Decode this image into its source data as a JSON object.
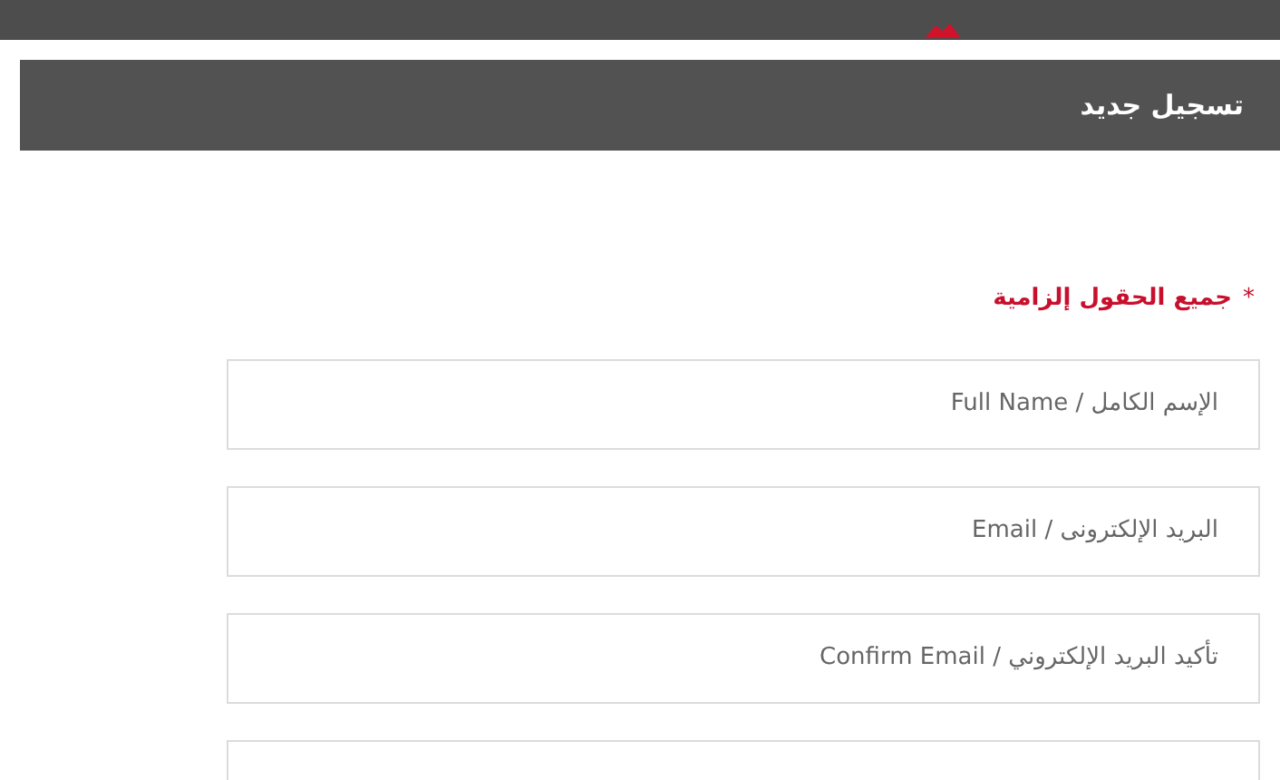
{
  "header": {
    "logo": {
      "kind": "logo"
    }
  },
  "section_title": "تسجيل جديد",
  "required_note": {
    "mark": "*",
    "text": "جميع الحقول إلزامية"
  },
  "fields": [
    {
      "kind": "input",
      "placeholder": "الإسم الكامل / Full Name"
    },
    {
      "kind": "input",
      "placeholder": "البريد الإلكترونى / Email"
    },
    {
      "kind": "input",
      "placeholder": "تأكيد البريد الإلكتروني / Confirm Email"
    },
    {
      "kind": "input"
    }
  ]
}
